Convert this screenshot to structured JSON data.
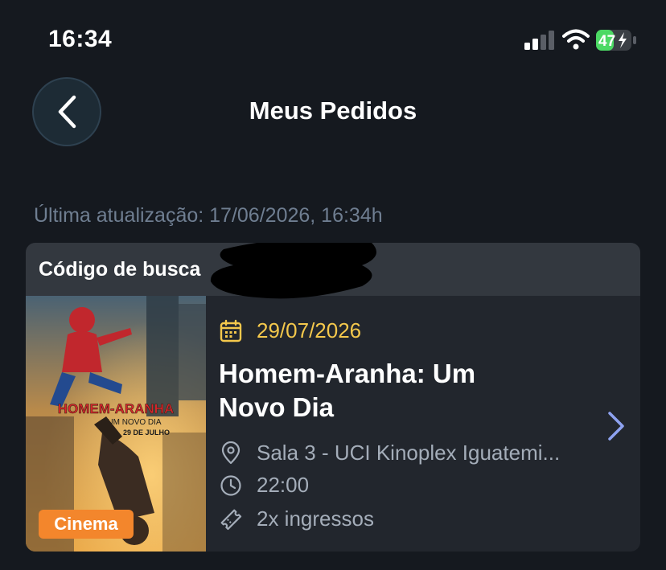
{
  "status_bar": {
    "time": "16:34",
    "battery_level": "47",
    "battery_color": "#4cd964"
  },
  "header": {
    "back_icon": "chevron-left-icon",
    "title": "Meus Pedidos"
  },
  "last_updated": "Última atualização: 17/06/2026, 16:34h",
  "order": {
    "search_code_label": "Código de busca",
    "category_tag": "Cinema",
    "date": "29/07/2026",
    "movie_title": "Homem-Aranha: Um Novo Dia",
    "venue": "Sala 3 - UCI Kinoplex Iguatemi...",
    "time": "22:00",
    "tickets": "2x ingressos",
    "poster": {
      "title": "HOMEM-ARANHA",
      "subtitle": "UM NOVO DIA",
      "release": "29 DE JULHO"
    },
    "icons": {
      "date": "calendar-icon",
      "venue": "location-pin-icon",
      "time": "clock-icon",
      "tickets": "ticket-icon",
      "open": "chevron-right-icon"
    }
  },
  "colors": {
    "background": "#15191f",
    "accent_date": "#f4c84c",
    "tag": "#f3862c",
    "chevron": "#8ea2f0"
  }
}
